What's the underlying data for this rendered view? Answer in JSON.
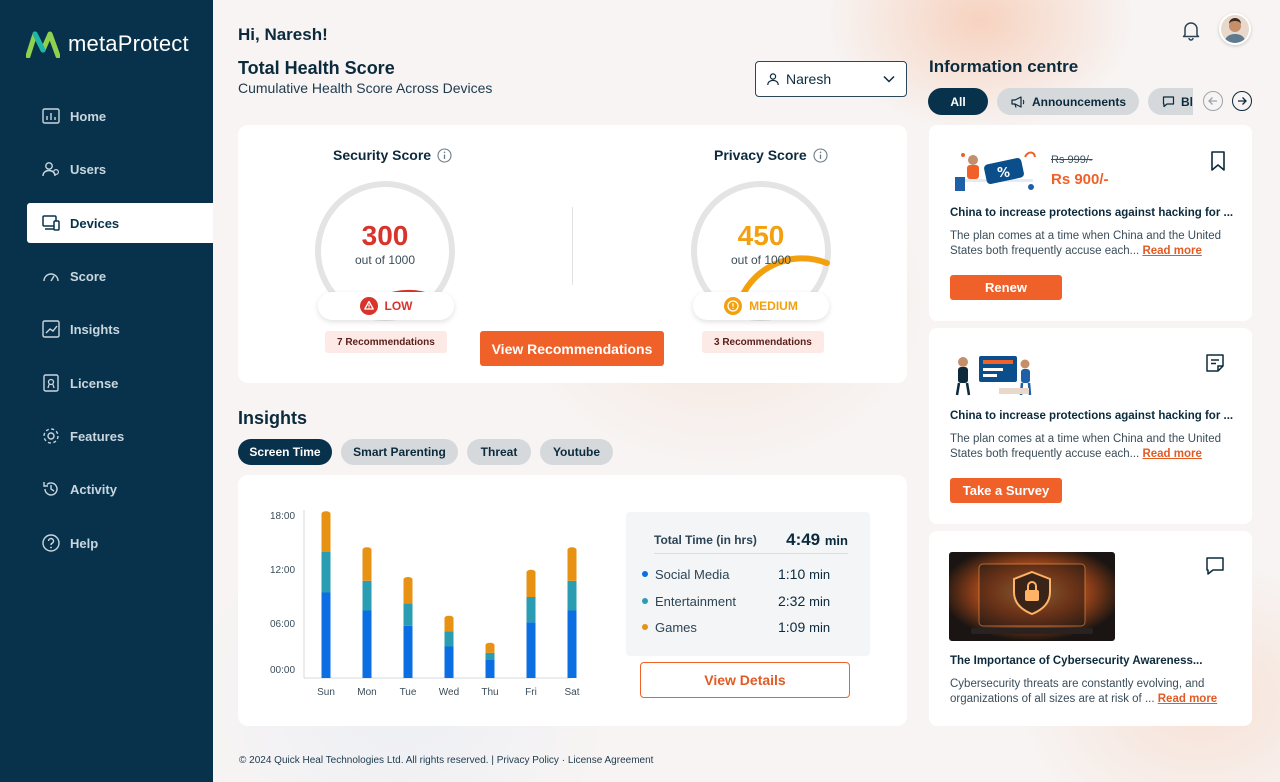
{
  "app": {
    "name": "metaProtect",
    "brand_color": "#08324b",
    "accent_color": "#f0612a"
  },
  "sidebar": {
    "items": [
      {
        "label": "Home",
        "icon": "home-chart-icon"
      },
      {
        "label": "Users",
        "icon": "users-icon"
      },
      {
        "label": "Devices",
        "icon": "devices-icon",
        "active": true
      },
      {
        "label": "Score",
        "icon": "gauge-icon"
      },
      {
        "label": "Insights",
        "icon": "insights-chart-icon"
      },
      {
        "label": "License",
        "icon": "license-icon"
      },
      {
        "label": "Features",
        "icon": "gear-icon"
      },
      {
        "label": "Activity",
        "icon": "history-icon"
      },
      {
        "label": "Help",
        "icon": "help-icon"
      }
    ]
  },
  "header": {
    "greeting": "Hi, Naresh!"
  },
  "health": {
    "title": "Total Health Score",
    "subtitle": "Cumulative Health Score Across Devices",
    "user_select": {
      "value": "Naresh"
    },
    "security": {
      "label": "Security Score",
      "score": "300",
      "out_of": "out of 1000",
      "score_value": 300,
      "max": 1000,
      "level": "LOW",
      "level_color": "#d8342c",
      "recommendations": "7 Recommendations"
    },
    "privacy": {
      "label": "Privacy Score",
      "score": "450",
      "out_of": "out of 1000",
      "score_value": 450,
      "max": 1000,
      "level": "MEDIUM",
      "level_color": "#f3a00f",
      "recommendations": "3 Recommendations"
    },
    "view_button": "View Recommendations"
  },
  "insights": {
    "title": "Insights",
    "tabs": [
      "Screen Time",
      "Smart Parenting",
      "Threat",
      "Youtube"
    ],
    "active_tab": "Screen Time",
    "totals": {
      "label": "Total Time (in hrs)",
      "value": "4:49",
      "unit": "min",
      "rows": [
        {
          "name": "Social Media",
          "value": "1:10",
          "unit": "min",
          "color": "#0b6fe3"
        },
        {
          "name": "Entertainment",
          "value": "2:32",
          "unit": "min",
          "color": "#2b9db3"
        },
        {
          "name": "Games",
          "value": "1:09",
          "unit": "min",
          "color": "#e89213"
        }
      ]
    },
    "view_details": "View Details"
  },
  "chart_data": {
    "type": "bar",
    "stacked": true,
    "categories": [
      "Sun",
      "Mon",
      "Tue",
      "Wed",
      "Thu",
      "Fri",
      "Sat"
    ],
    "y_ticks": [
      "18:00",
      "12:00",
      "06:00",
      "00:00"
    ],
    "ylim": [
      0,
      18
    ],
    "series": [
      {
        "name": "Social Media",
        "color": "#0b6fe3",
        "values": [
          9.5,
          7.5,
          5.8,
          3.5,
          2.0,
          6.2,
          7.5
        ]
      },
      {
        "name": "Entertainment",
        "color": "#2b9db3",
        "values": [
          4.5,
          3.3,
          2.5,
          1.7,
          0.8,
          2.8,
          3.3
        ]
      },
      {
        "name": "Games",
        "color": "#e89213",
        "values": [
          4.3,
          3.5,
          2.7,
          1.5,
          0.9,
          2.8,
          3.5
        ]
      }
    ],
    "grid": false
  },
  "footer": {
    "text": "© 2024 Quick Heal Technologies Ltd. All rights reserved. | Privacy Policy · License Agreement"
  },
  "info_centre": {
    "title": "Information centre",
    "tabs": [
      {
        "label": "All",
        "active": true
      },
      {
        "label": "Announcements",
        "icon": "megaphone-icon"
      },
      {
        "label": "Blog",
        "icon": "chat-bubble-icon"
      }
    ],
    "cards": [
      {
        "price_old": "Rs 999/-",
        "price_new": "Rs 900/-",
        "title": "China to increase protections against hacking for ...",
        "body": "The plan comes at a time when China and the United States both frequently accuse each...",
        "read_more": "Read more",
        "button": "Renew",
        "corner_icon": "bookmark-icon"
      },
      {
        "title": "China to increase protections against hacking for ...",
        "body": "The plan comes at a time when China and the United States both frequently accuse each...",
        "read_more": "Read more",
        "button": "Take a Survey",
        "corner_icon": "survey-note-icon"
      },
      {
        "title": "The Importance of Cybersecurity Awareness...",
        "body": "Cybersecurity threats are constantly evolving, and organizations of all sizes are at risk of ...",
        "read_more": "Read more",
        "corner_icon": "chat-bubble-icon"
      }
    ]
  }
}
